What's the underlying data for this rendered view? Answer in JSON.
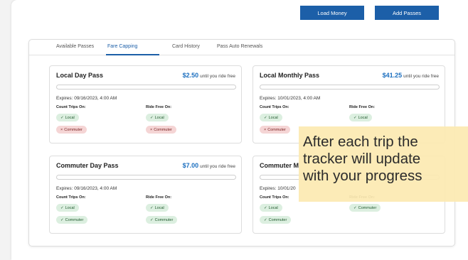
{
  "header": {
    "load_money_label": "Load Money",
    "add_passes_label": "Add Passes"
  },
  "tabs": [
    {
      "label": "Available Passes"
    },
    {
      "label": "Fare Capping",
      "active": true
    },
    {
      "label": "Card History"
    },
    {
      "label": "Pass Auto Renewals"
    }
  ],
  "labels": {
    "count_trips_on": "Count Trips On:",
    "ride_free_on": "Ride Free On:",
    "until_free": "until you ride free"
  },
  "passes": [
    {
      "name": "Local Day Pass",
      "amount": "$2.50",
      "expires": "Expires: 09/16/2023, 4:00 AM",
      "count_trips_on": [
        {
          "label": "Local",
          "enabled": true
        },
        {
          "label": "Commuter",
          "enabled": false
        }
      ],
      "ride_free_on": [
        {
          "label": "Local",
          "enabled": true
        },
        {
          "label": "Commuter",
          "enabled": false
        }
      ]
    },
    {
      "name": "Local Monthly Pass",
      "amount": "$41.25",
      "expires": "Expires: 10/01/2023, 4:00 AM",
      "count_trips_on": [
        {
          "label": "Local",
          "enabled": true
        },
        {
          "label": "Commuter",
          "enabled": false
        }
      ],
      "ride_free_on": [
        {
          "label": "Local",
          "enabled": true
        }
      ]
    },
    {
      "name": "Commuter Day Pass",
      "amount": "$7.00",
      "expires": "Expires: 09/16/2023, 4:00 AM",
      "count_trips_on": [
        {
          "label": "Local",
          "enabled": true
        },
        {
          "label": "Commuter",
          "enabled": true
        }
      ],
      "ride_free_on": [
        {
          "label": "Local",
          "enabled": true
        },
        {
          "label": "Commuter",
          "enabled": true
        }
      ]
    },
    {
      "name": "Commuter M",
      "amount": "",
      "expires": "Expires: 10/01/20",
      "count_trips_on": [
        {
          "label": "Local",
          "enabled": true
        },
        {
          "label": "Commuter",
          "enabled": true
        }
      ],
      "ride_free_on": [
        {
          "label": "Commuter",
          "enabled": true
        }
      ]
    }
  ],
  "overlay": {
    "line1": "After each trip the",
    "line2": "tracker will update",
    "line3": "with your progress"
  },
  "colors": {
    "brand_blue": "#1c5fa8",
    "price_blue": "#1c6fbf",
    "chip_enabled_bg": "#dcefe0",
    "chip_disabled_bg": "#f5d5d5",
    "overlay_bg": "#fce9b2"
  },
  "icons": {
    "enabled": "check-icon",
    "disabled": "x-icon"
  }
}
